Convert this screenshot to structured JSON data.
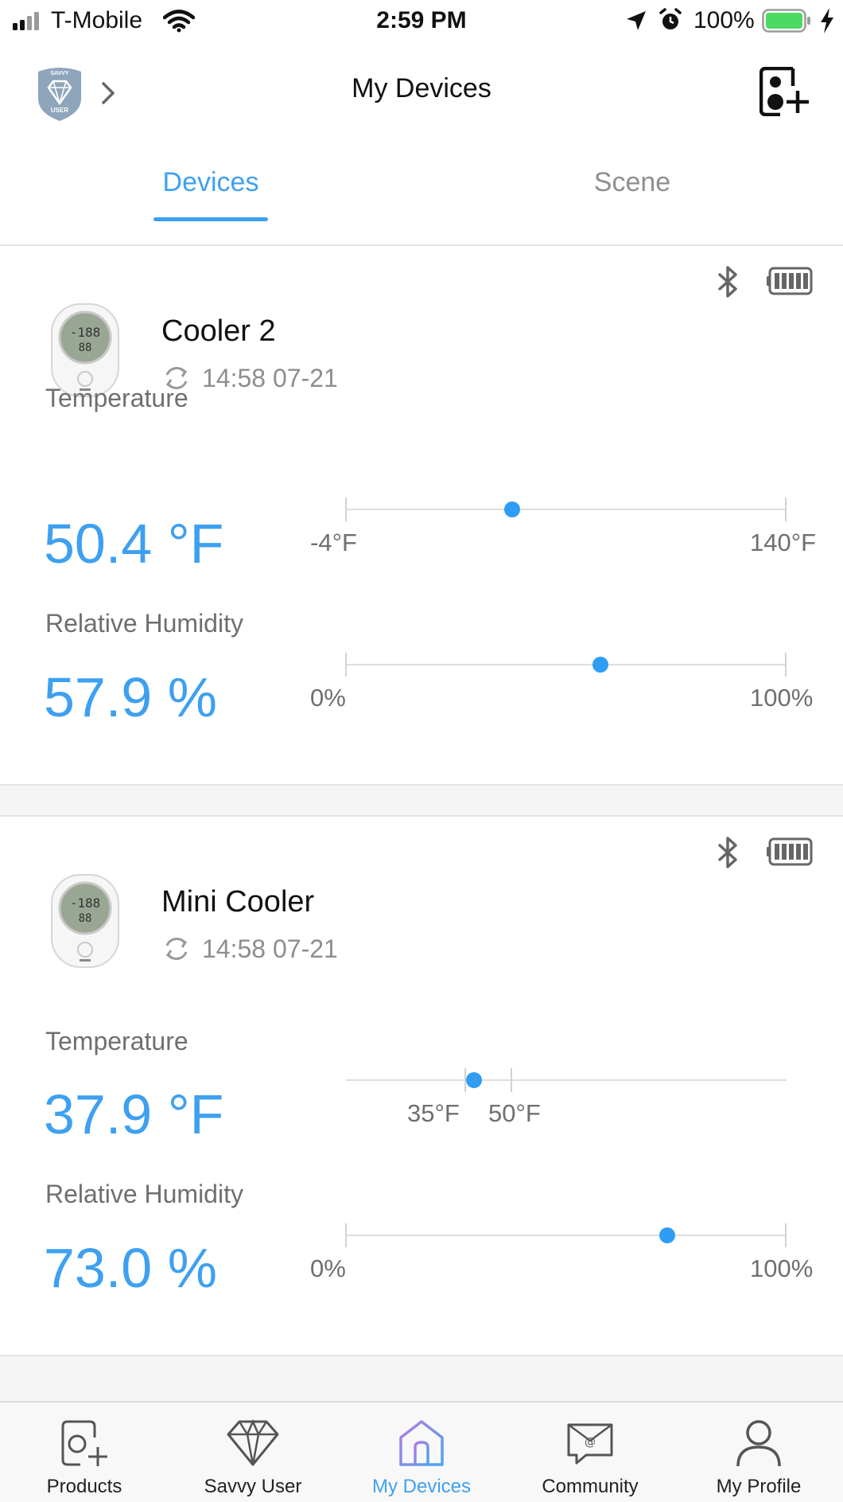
{
  "status_bar": {
    "carrier": "T-Mobile",
    "time": "2:59 PM",
    "battery": "100%"
  },
  "header": {
    "title": "My Devices",
    "badge_text_top": "SAVVY",
    "badge_text_bottom": "USER"
  },
  "tabs": [
    {
      "label": "Devices",
      "active": true
    },
    {
      "label": "Scene",
      "active": false
    }
  ],
  "devices": [
    {
      "name": "Cooler 2",
      "updated": "14:58 07-21",
      "temperature": {
        "label": "Temperature",
        "value": "50.4 °F",
        "min_label": "-4°F",
        "max_label": "140°F"
      },
      "humidity": {
        "label": "Relative Humidity",
        "value": "57.9 %",
        "min_label": "0%",
        "max_label": "100%"
      }
    },
    {
      "name": "Mini Cooler",
      "updated": "14:58 07-21",
      "temperature": {
        "label": "Temperature",
        "value": "37.9 °F",
        "min_label": "35°F",
        "max_label": "50°F"
      },
      "humidity": {
        "label": "Relative Humidity",
        "value": "73.0 %",
        "min_label": "0%",
        "max_label": "100%"
      }
    }
  ],
  "bottom_nav": [
    {
      "label": "Products",
      "icon": "add-device-icon",
      "active": false
    },
    {
      "label": "Savvy User",
      "icon": "diamond-icon",
      "active": false
    },
    {
      "label": "My Devices",
      "icon": "home-icon",
      "active": true
    },
    {
      "label": "Community",
      "icon": "mail-at-icon",
      "active": false
    },
    {
      "label": "My Profile",
      "icon": "person-icon",
      "active": false
    }
  ],
  "colors": {
    "accent": "#3ea0f0",
    "battery_green": "#4cd964"
  }
}
